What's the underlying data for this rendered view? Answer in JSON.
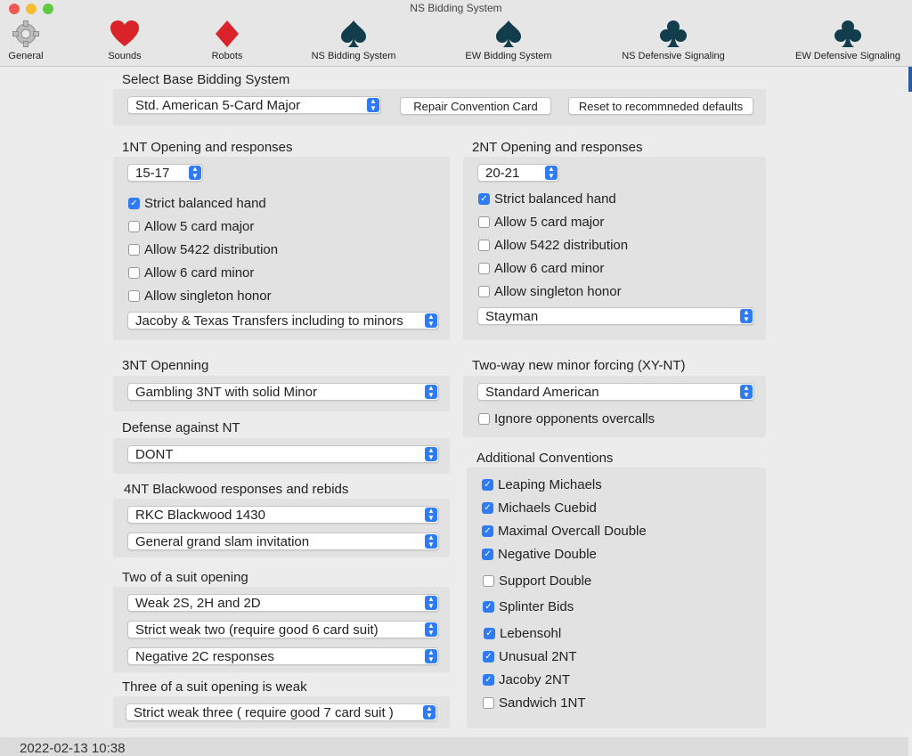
{
  "window": {
    "title": "NS Bidding System"
  },
  "toolbar": [
    {
      "label": "General",
      "icon": "gear-icon"
    },
    {
      "label": "Sounds",
      "icon": "heart-icon"
    },
    {
      "label": "Robots",
      "icon": "diamond-icon"
    },
    {
      "label": "NS Bidding System",
      "icon": "spade-icon"
    },
    {
      "label": "EW Bidding System",
      "icon": "spade-icon"
    },
    {
      "label": "NS Defensive Signaling",
      "icon": "club-icon"
    },
    {
      "label": "EW Defensive Signaling",
      "icon": "club-icon"
    }
  ],
  "base": {
    "title": "Select Base Bidding System",
    "value": "Std. American 5-Card Major",
    "repair_label": "Repair Convention Card",
    "reset_label": "Reset to recommneded defaults"
  },
  "nt1": {
    "title": "1NT Opening and responses",
    "range": "15-17",
    "options": [
      {
        "label": "Strict balanced hand",
        "checked": true
      },
      {
        "label": "Allow 5 card major",
        "checked": false
      },
      {
        "label": "Allow 5422 distribution",
        "checked": false
      },
      {
        "label": "Allow 6 card minor",
        "checked": false
      },
      {
        "label": "Allow singleton honor",
        "checked": false
      }
    ],
    "transfers": "Jacoby & Texas Transfers including to minors"
  },
  "nt2": {
    "title": "2NT Opening and responses",
    "range": "20-21",
    "options": [
      {
        "label": "Strict balanced hand",
        "checked": true
      },
      {
        "label": "Allow 5 card major",
        "checked": false
      },
      {
        "label": "Allow 5422 distribution",
        "checked": false
      },
      {
        "label": "Allow 6 card minor",
        "checked": false
      },
      {
        "label": "Allow singleton honor",
        "checked": false
      }
    ],
    "convention": "Stayman"
  },
  "nt3": {
    "title": "3NT Openning",
    "value": "Gambling 3NT with solid Minor"
  },
  "twoway": {
    "title": "Two-way new minor forcing (XY-NT)",
    "value": "Standard American",
    "ignore_label": "Ignore opponents overcalls",
    "ignore_checked": false
  },
  "defense": {
    "title": "Defense against NT",
    "value": "DONT"
  },
  "blackwood": {
    "title": "4NT Blackwood responses and rebids",
    "value1": "RKC Blackwood 1430",
    "value2": "General grand slam invitation"
  },
  "twosuit": {
    "title": "Two of a suit opening",
    "value1": "Weak 2S, 2H and 2D",
    "value2": "Strict weak two (require  good 6 card suit)",
    "value3": "Negative 2C responses"
  },
  "threesuit": {
    "title": "Three of a suit opening is weak",
    "value": "Strict weak three ( require good  7 card suit )"
  },
  "additional": {
    "title": "Additional Conventions",
    "items": [
      {
        "label": "Leaping Michaels",
        "checked": true
      },
      {
        "label": "Michaels Cuebid",
        "checked": true
      },
      {
        "label": "Maximal Overcall Double",
        "checked": true
      },
      {
        "label": "Negative Double",
        "checked": true
      },
      {
        "label": "Support Double",
        "checked": false
      },
      {
        "label": "Splinter Bids",
        "checked": true
      },
      {
        "label": "Lebensohl",
        "checked": true
      },
      {
        "label": "Unusual 2NT",
        "checked": true
      },
      {
        "label": "Jacoby 2NT",
        "checked": true
      },
      {
        "label": "Sandwich 1NT",
        "checked": false
      }
    ]
  },
  "background": {
    "bottom_text": "2022-02-13 10:38"
  },
  "colors": {
    "accent": "#2f7bf5",
    "heart": "#d9222a",
    "spade": "#123d4d"
  }
}
